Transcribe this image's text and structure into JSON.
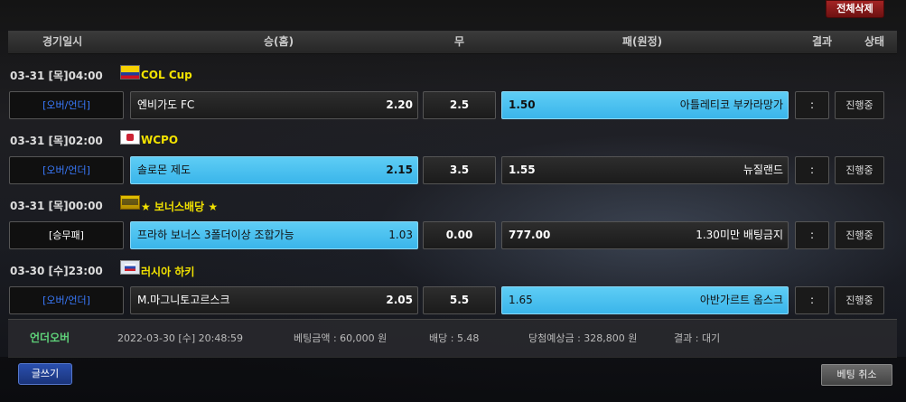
{
  "toolbar": {
    "delete_all": "전체삭제"
  },
  "header": {
    "datetime": "경기일시",
    "home": "승(홈)",
    "draw": "무",
    "away": "패(원정)",
    "result": "결과",
    "status": "상태"
  },
  "bets": [
    {
      "date": "03-31 [목]04:00",
      "league": "COL Cup",
      "flag": "colombia-flag",
      "bet_type": "[오버/언더]",
      "home_team": "엔비가도 FC",
      "home_odds": "2.20",
      "draw_value": "2.5",
      "away_odds": "1.50",
      "away_team": "아틀레티코 부카라망가",
      "selected": "away",
      "result": ":",
      "status": "진행중"
    },
    {
      "date": "03-31 [목]02:00",
      "league": "WCPO",
      "flag": "wcpo-flag",
      "bet_type": "[오버/언더]",
      "home_team": "솔로몬 제도",
      "home_odds": "2.15",
      "draw_value": "3.5",
      "away_odds": "1.55",
      "away_team": "뉴질랜드",
      "selected": "home",
      "result": ":",
      "status": "진행중"
    },
    {
      "date": "03-31 [목]00:00",
      "league": "★ 보너스배당 ★",
      "flag": "bonus-flag",
      "bet_type": "[승무패]",
      "home_team": "프라하 보너스 3폴더이상 조합가능",
      "home_odds": "1.03",
      "draw_value": "0.00",
      "away_odds": "777.00",
      "away_team": "1.30미만 배팅금지",
      "selected": "home",
      "result": ":",
      "status": "진행중"
    },
    {
      "date": "03-30 [수]23:00",
      "league": "러시아 하키",
      "flag": "russia-hockey-flag",
      "bet_type": "[오버/언더]",
      "home_team": "M.마그니토고르스크",
      "home_odds": "2.05",
      "draw_value": "5.5",
      "away_odds": "1.65",
      "away_team": "아반가르트 옴스크",
      "selected": "away",
      "result": ":",
      "status": "진행중"
    }
  ],
  "summary": {
    "kind": "언더오버",
    "datetime": "2022-03-30 [수] 20:48:59",
    "amount": "베팅금액 : 60,000 원",
    "odds": "배당 : 5.48",
    "expected": "당첨예상금 : 328,800 원",
    "result": "결과 : 대기"
  },
  "buttons": {
    "write": "글쓰기",
    "cancel": "베팅 취소"
  },
  "colors": {
    "selected": "#4cc3f0",
    "league": "#f2e200",
    "bet_type_ou": "#3a7bff",
    "delete": "#a32424"
  }
}
